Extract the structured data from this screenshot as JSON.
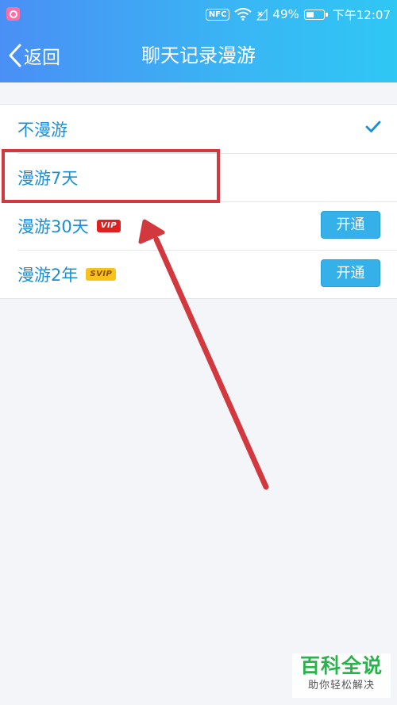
{
  "status_bar": {
    "nfc": "NFC",
    "battery": "49%",
    "battery_level": 0.49,
    "time": "下午12:07"
  },
  "title_bar": {
    "back_label": "返回",
    "title": "聊天记录漫游"
  },
  "options": [
    {
      "label": "不漫游",
      "selected": true
    },
    {
      "label": "漫游7天"
    },
    {
      "label": "漫游30天",
      "badge": "VIP",
      "button": "开通"
    },
    {
      "label": "漫游2年",
      "badge": "SVIP",
      "button": "开通"
    }
  ],
  "colors": {
    "accent": "#1a8fd6",
    "header_start": "#4a8ff5",
    "header_end": "#2fc7f4",
    "annotation": "#d2393f",
    "vip_badge": "#e0201f",
    "svip_badge": "#f7c21b"
  },
  "watermark": {
    "title": "百科全说",
    "subtitle": "助你轻松解决"
  }
}
